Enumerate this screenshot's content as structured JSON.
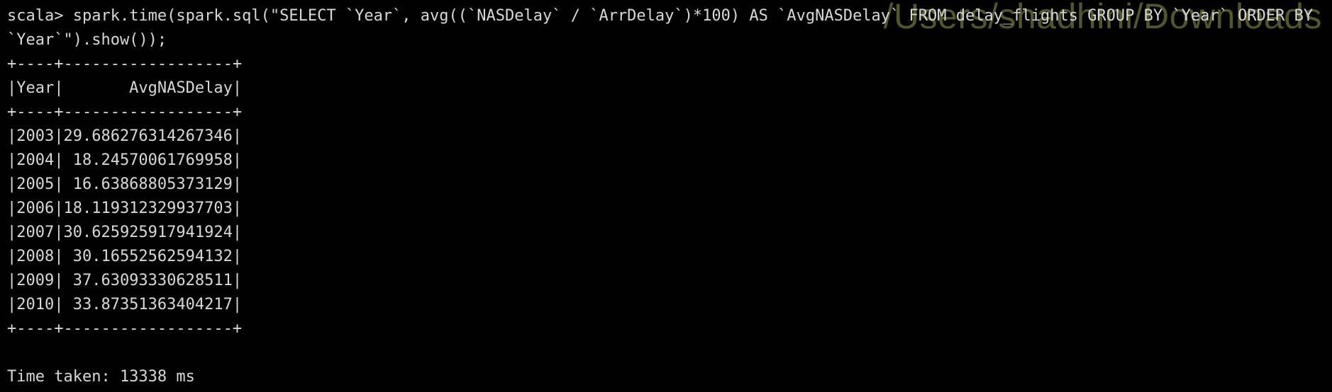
{
  "watermark": "/Users/shadhini/Downloads",
  "prompt": "scala> ",
  "command": "spark.time(spark.sql(\"SELECT `Year`, avg((`NASDelay` / `ArrDelay`)*100) AS `AvgNASDelay` FROM delay_flights GROUP BY `Year` ORDER BY `Year`\").show());",
  "table": {
    "border": "+----+------------------+",
    "header": "|Year|       AvgNASDelay|",
    "rows": [
      "|2003|29.686276314267346|",
      "|2004| 18.24570061769958|",
      "|2005| 16.63868805373129|",
      "|2006|18.119312329937703|",
      "|2007|30.625925917941924|",
      "|2008| 30.16552562594132|",
      "|2009| 37.63093330628511|",
      "|2010| 33.87351363404217|"
    ]
  },
  "time_taken": "Time taken: 13338 ms"
}
